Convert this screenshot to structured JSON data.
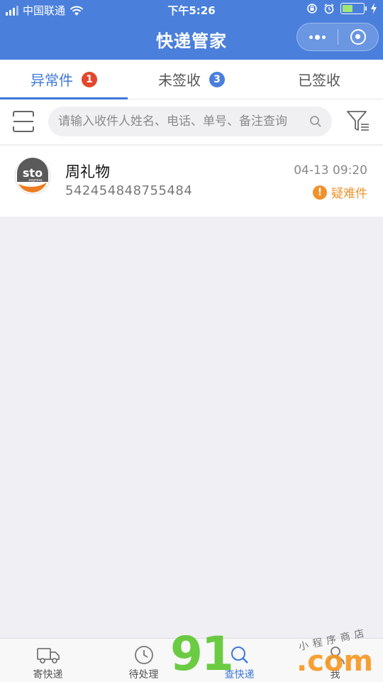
{
  "status_bar": {
    "carrier": "中国联通",
    "time": "下午5:26"
  },
  "header": {
    "title": "快递管家"
  },
  "tabs": [
    {
      "label": "异常件",
      "badge": "1",
      "badge_color": "#e2482d",
      "active": true
    },
    {
      "label": "未签收",
      "badge": "3",
      "badge_color": "#4a7fdc",
      "active": false
    },
    {
      "label": "已签收",
      "badge": "",
      "active": false
    }
  ],
  "search": {
    "placeholder": "请输入收件人姓名、电话、单号、备注查询"
  },
  "list": [
    {
      "logo": "sto-express-logo",
      "name": "周礼物",
      "tracking_number": "542454848755484",
      "time": "04-13 09:20",
      "status": "疑难件",
      "status_color": "#f0912b"
    }
  ],
  "bottom_nav": [
    {
      "label": "寄快递",
      "icon": "truck-icon",
      "active": false
    },
    {
      "label": "待处理",
      "icon": "clock-icon",
      "active": false
    },
    {
      "label": "查快递",
      "icon": "magnifier-icon",
      "active": true
    },
    {
      "label": "我",
      "icon": "person-icon",
      "active": false
    }
  ],
  "colors": {
    "primary": "#4a7fdc",
    "warning": "#f0912b",
    "badge_red": "#e2482d"
  },
  "watermark": {
    "main": "91",
    "suffix": ".com",
    "tagline": "小程序商店"
  }
}
